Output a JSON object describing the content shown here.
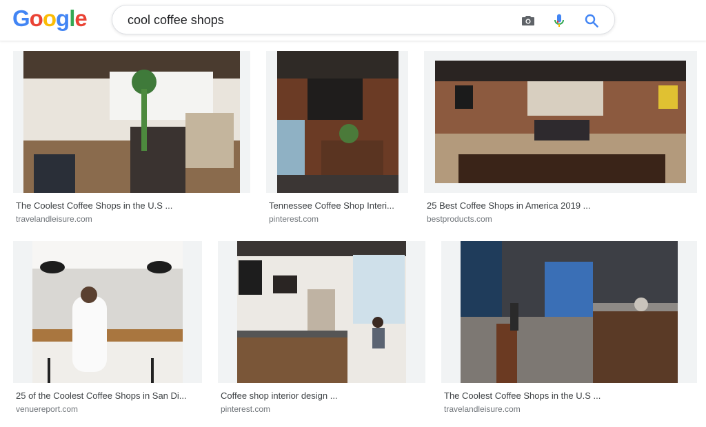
{
  "logo": {
    "letters": [
      "G",
      "o",
      "o",
      "g",
      "l",
      "e"
    ]
  },
  "search": {
    "query": "cool coffee shops"
  },
  "icons": {
    "camera": "camera-icon",
    "mic": "mic-icon",
    "search": "search-icon"
  },
  "colors": {
    "blue": "#4285f4",
    "red": "#ea4335",
    "yellow": "#fbbc05",
    "green": "#34a853"
  },
  "results": [
    {
      "title": "The Coolest Coffee Shops in the U.S ...",
      "domain": "travelandleisure.com"
    },
    {
      "title": "Tennessee Coffee Shop Interi...",
      "domain": "pinterest.com"
    },
    {
      "title": "25 Best Coffee Shops in America 2019 ...",
      "domain": "bestproducts.com"
    },
    {
      "title": "25 of the Coolest Coffee Shops in San Di...",
      "domain": "venuereport.com"
    },
    {
      "title": "Coffee shop interior design ...",
      "domain": "pinterest.com"
    },
    {
      "title": "The Coolest Coffee Shops in the U.S ...",
      "domain": "travelandleisure.com"
    }
  ]
}
